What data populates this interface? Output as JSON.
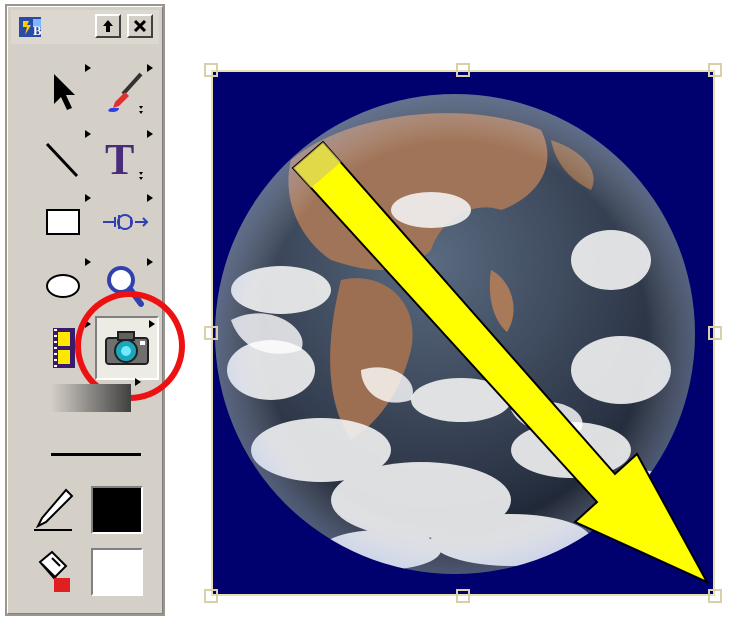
{
  "toolbox": {
    "title_icon": "toolbox-app-icon",
    "float_button": "float-arrow-icon",
    "close_button": "close-x-icon",
    "tools": [
      {
        "id": "select",
        "icon": "arrow-pointer-icon"
      },
      {
        "id": "paint",
        "icon": "paintbrush-icon"
      },
      {
        "id": "line",
        "icon": "line-icon"
      },
      {
        "id": "text",
        "icon": "text-t-icon"
      },
      {
        "id": "rectangle",
        "icon": "rectangle-icon"
      },
      {
        "id": "connector",
        "icon": "connector-icon"
      },
      {
        "id": "ellipse",
        "icon": "ellipse-icon"
      },
      {
        "id": "zoom",
        "icon": "magnifier-icon"
      },
      {
        "id": "media",
        "icon": "film-strip-icon"
      },
      {
        "id": "camera",
        "icon": "camera-icon",
        "selected": true
      }
    ],
    "line_color": "#000000",
    "fill_color": "#ffffff",
    "highlight_color": "#ee1111"
  },
  "canvas": {
    "background": "#00006e",
    "image": "earth-globe",
    "arrow_color": "#ffff00"
  }
}
